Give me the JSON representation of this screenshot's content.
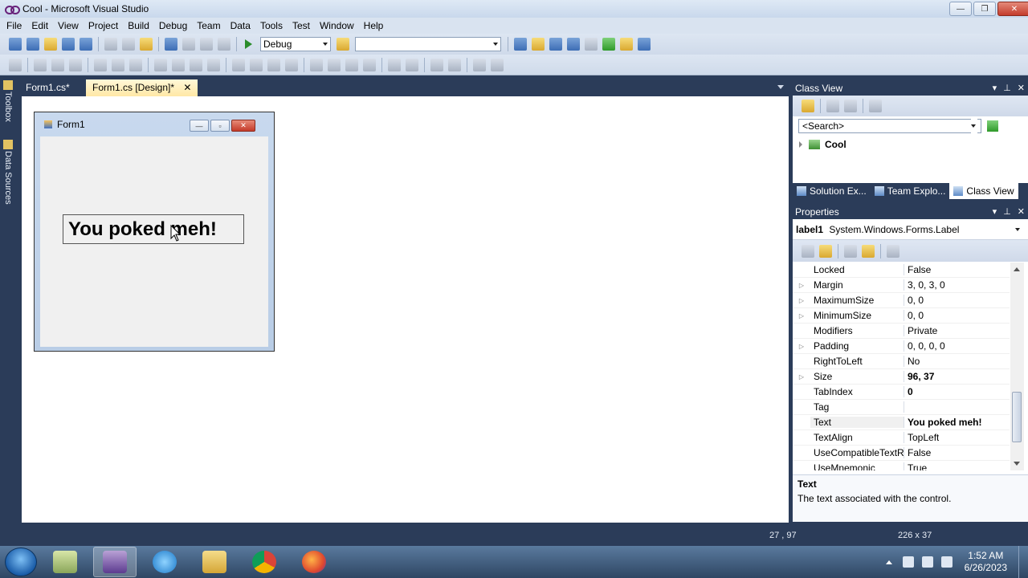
{
  "window": {
    "title": "Cool - Microsoft Visual Studio",
    "controls": {
      "minimize": "—",
      "maximize": "❐",
      "close": "✕"
    }
  },
  "menu": [
    "File",
    "Edit",
    "View",
    "Project",
    "Build",
    "Debug",
    "Team",
    "Data",
    "Tools",
    "Test",
    "Window",
    "Help"
  ],
  "toolbar": {
    "config": "Debug",
    "platform": ""
  },
  "sidebar": {
    "toolbox": "Toolbox",
    "data_sources": "Data Sources"
  },
  "tabs": [
    {
      "label": "Form1.cs*",
      "active": false
    },
    {
      "label": "Form1.cs [Design]*",
      "active": true,
      "close": "✕"
    }
  ],
  "designer": {
    "form_title": "Form1",
    "form_controls": {
      "minimize": "—",
      "maximize": "▫",
      "close": "✕"
    },
    "label_text": "You poked meh!"
  },
  "status": {
    "position": "27 , 97",
    "size": "226 x 37"
  },
  "class_view": {
    "title": "Class View",
    "search_placeholder": "<Search>",
    "tree_root": "Cool",
    "header_controls": {
      "dropdown": "▾",
      "pin": "⊥",
      "close": "✕"
    }
  },
  "pane_tabs": [
    "Solution Ex...",
    "Team Explo...",
    "Class View"
  ],
  "properties": {
    "title": "Properties",
    "object_name": "label1",
    "object_type": "System.Windows.Forms.Label",
    "rows": [
      {
        "name": "Locked",
        "value": "False",
        "expandable": false,
        "bold": false
      },
      {
        "name": "Margin",
        "value": "3, 0, 3, 0",
        "expandable": true,
        "bold": false
      },
      {
        "name": "MaximumSize",
        "value": "0, 0",
        "expandable": true,
        "bold": false
      },
      {
        "name": "MinimumSize",
        "value": "0, 0",
        "expandable": true,
        "bold": false
      },
      {
        "name": "Modifiers",
        "value": "Private",
        "expandable": false,
        "bold": false
      },
      {
        "name": "Padding",
        "value": "0, 0, 0, 0",
        "expandable": true,
        "bold": false
      },
      {
        "name": "RightToLeft",
        "value": "No",
        "expandable": false,
        "bold": false
      },
      {
        "name": "Size",
        "value": "96, 37",
        "expandable": true,
        "bold": true
      },
      {
        "name": "TabIndex",
        "value": "0",
        "expandable": false,
        "bold": true
      },
      {
        "name": "Tag",
        "value": "",
        "expandable": false,
        "bold": false
      },
      {
        "name": "Text",
        "value": "You poked meh!",
        "expandable": false,
        "bold": true,
        "selected": true
      },
      {
        "name": "TextAlign",
        "value": "TopLeft",
        "expandable": false,
        "bold": false
      },
      {
        "name": "UseCompatibleTextRe",
        "value": "False",
        "expandable": false,
        "bold": false
      },
      {
        "name": "UseMnemonic",
        "value": "True",
        "expandable": false,
        "bold": false
      }
    ],
    "description_title": "Text",
    "description_text": "The text associated with the control."
  },
  "taskbar": {
    "time": "1:52 AM",
    "date": "6/26/2023"
  }
}
